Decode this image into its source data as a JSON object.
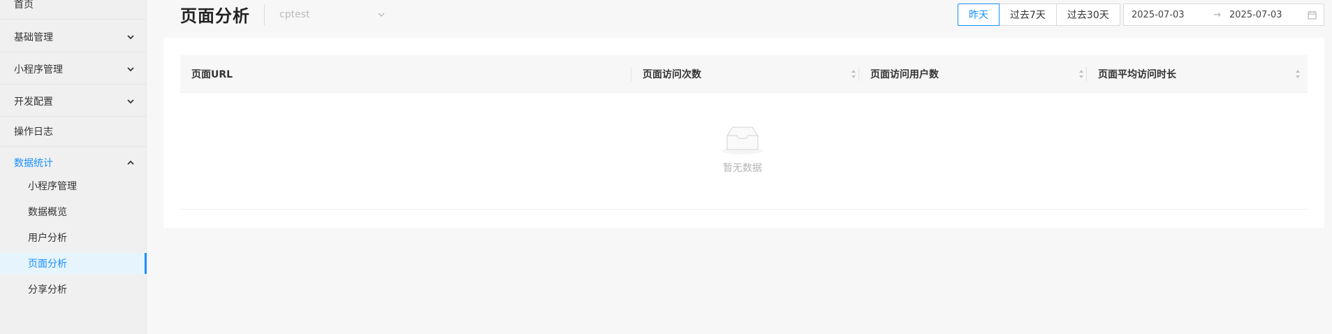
{
  "sidebar": {
    "items": [
      {
        "label": "首页"
      },
      {
        "label": "基础管理"
      },
      {
        "label": "小程序管理"
      },
      {
        "label": "开发配置"
      },
      {
        "label": "操作日志"
      },
      {
        "label": "数据统计"
      }
    ],
    "sub_items": [
      {
        "label": "小程序管理"
      },
      {
        "label": "数据概览"
      },
      {
        "label": "用户分析"
      },
      {
        "label": "页面分析"
      },
      {
        "label": "分享分析"
      }
    ],
    "selected_sub_item": "页面分析"
  },
  "header": {
    "title": "页面分析",
    "app_select_value": "cptest",
    "range_buttons": [
      "昨天",
      "过去7天",
      "过去30天"
    ],
    "active_range": "昨天",
    "date_start": "2025-07-03",
    "date_end": "2025-07-03",
    "date_separator": "→"
  },
  "table": {
    "columns": [
      "页面URL",
      "页面访问次数",
      "页面访问用户数",
      "页面平均访问时长"
    ],
    "rows": [],
    "empty_text": "暂无数据"
  },
  "colors": {
    "accent": "#1890ff",
    "sidebar_bg": "#f0f0f0",
    "page_bg": "#f7f7f7"
  },
  "icons": {
    "menu_chevron_down": "chevron-down-icon",
    "menu_chevron_up": "chevron-up-icon",
    "select_chevron": "chevron-down-icon",
    "calendar": "calendar-icon",
    "sorter": "sort-icon",
    "empty": "empty-inbox-icon"
  }
}
